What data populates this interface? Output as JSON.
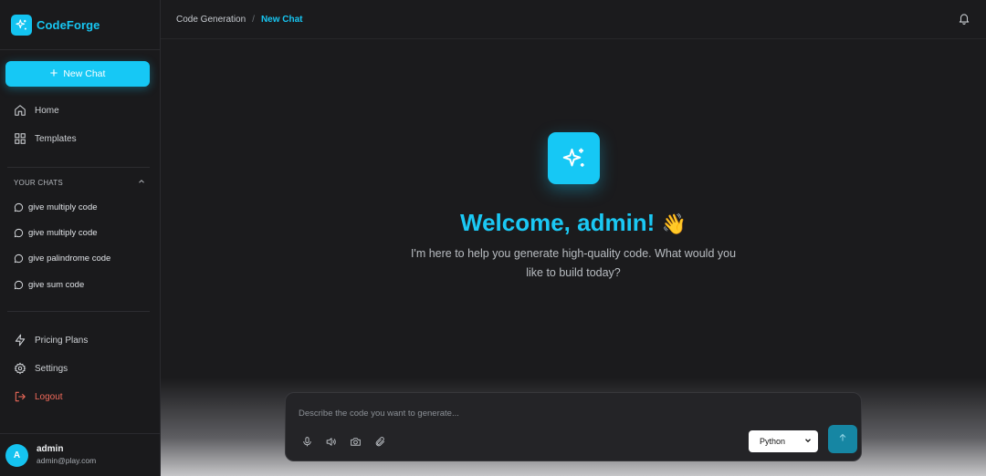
{
  "app": {
    "name": "CodeForge"
  },
  "sidebar": {
    "new_chat_label": "New Chat",
    "nav": [
      {
        "label": "Home",
        "icon": "home-icon"
      },
      {
        "label": "Templates",
        "icon": "grid-icon"
      }
    ],
    "chats_heading": "YOUR CHATS",
    "chats": [
      {
        "label": "give multiply code"
      },
      {
        "label": "give multiply code"
      },
      {
        "label": "give palindrome code"
      },
      {
        "label": "give sum code"
      }
    ],
    "bottom_nav": [
      {
        "label": "Pricing Plans",
        "icon": "lightning-icon"
      },
      {
        "label": "Settings",
        "icon": "gear-icon"
      },
      {
        "label": "Logout",
        "icon": "logout-icon"
      }
    ],
    "user": {
      "initial": "A",
      "name": "admin",
      "email": "admin@play.com"
    }
  },
  "header": {
    "breadcrumb": [
      "Code Generation",
      "/",
      "New Chat"
    ]
  },
  "main": {
    "welcome": "Welcome, admin!",
    "wave": "👋",
    "subtitle": "I'm here to help you generate high-quality code. What would you like to build today?"
  },
  "composer": {
    "placeholder": "Describe the code you want to generate...",
    "language": "Python"
  },
  "colors": {
    "accent": "#16c8f5",
    "logout": "#f06a5a",
    "background": "#1b1b1d"
  }
}
